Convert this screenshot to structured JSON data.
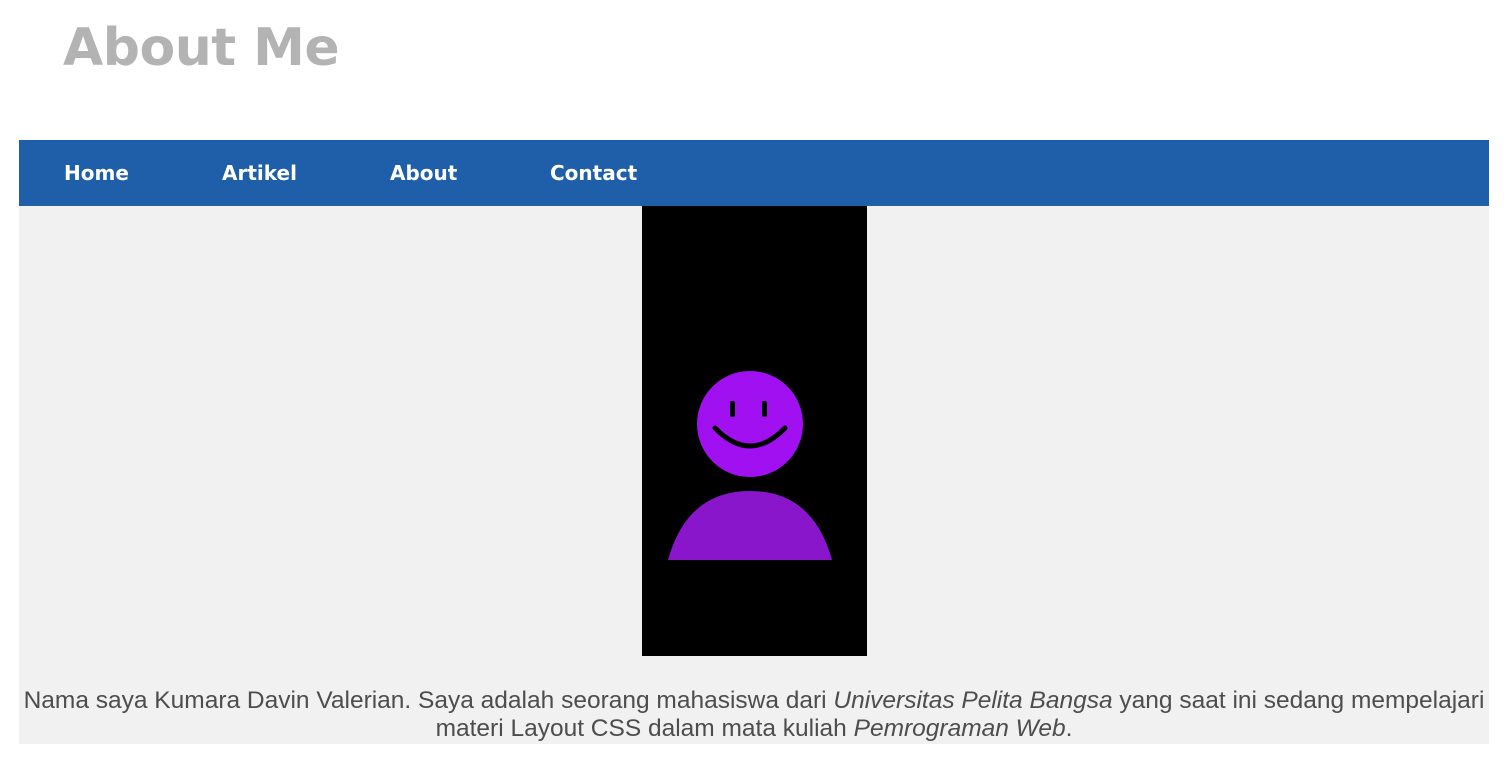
{
  "header": {
    "title": "About Me"
  },
  "nav": {
    "items": [
      {
        "label": "Home"
      },
      {
        "label": "Artikel"
      },
      {
        "label": "About"
      },
      {
        "label": "Contact"
      }
    ]
  },
  "profile": {
    "avatar_icon": "smiley-user-avatar-icon",
    "avatar_color": "#a010f0",
    "avatar_background": "#000000"
  },
  "bio": {
    "part1": "Nama saya Kumara Davin Valerian. Saya adalah seorang mahasiswa dari ",
    "university": "Universitas Pelita Bangsa",
    "part2": " yang saat ini sedang mempelajari materi Layout CSS dalam mata kuliah ",
    "course": "Pemrograman Web",
    "part3": "."
  },
  "colors": {
    "nav_background": "#1f5faa",
    "content_background": "#f1f1f1",
    "title_color": "#b3b3b3",
    "text_color": "#4d4d4d"
  }
}
